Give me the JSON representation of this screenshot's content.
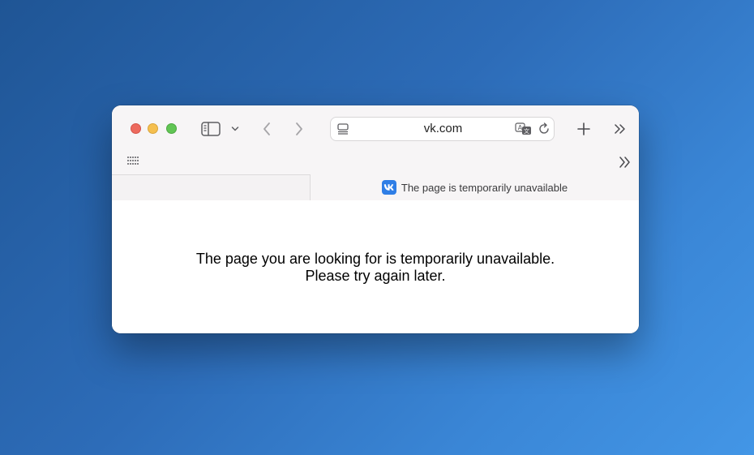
{
  "browser": {
    "address_bar": {
      "url": "vk.com"
    },
    "tabs": [
      {
        "title": "",
        "active": false
      },
      {
        "title": "The page is temporarily unavailable",
        "active": true,
        "favicon": "vk-logo-icon",
        "favicon_color": "#2f7ee6"
      }
    ],
    "icons": {
      "sidebar": "sidebar-icon",
      "back": "chevron-left-icon",
      "forward": "chevron-right-icon",
      "new_tab": "plus-icon",
      "overflow": "double-chevron-right-icon",
      "apps": "grid-icon",
      "translate": "translate-icon",
      "reload": "reload-icon"
    }
  },
  "page": {
    "message_line1": "The page you are looking for is temporarily unavailable.",
    "message_line2": "Please try again later."
  },
  "colors": {
    "traffic_close": "#ed6a5e",
    "traffic_minimize": "#f5bf4f",
    "traffic_maximize": "#61c554",
    "desktop_background": "#2d6cb8"
  }
}
